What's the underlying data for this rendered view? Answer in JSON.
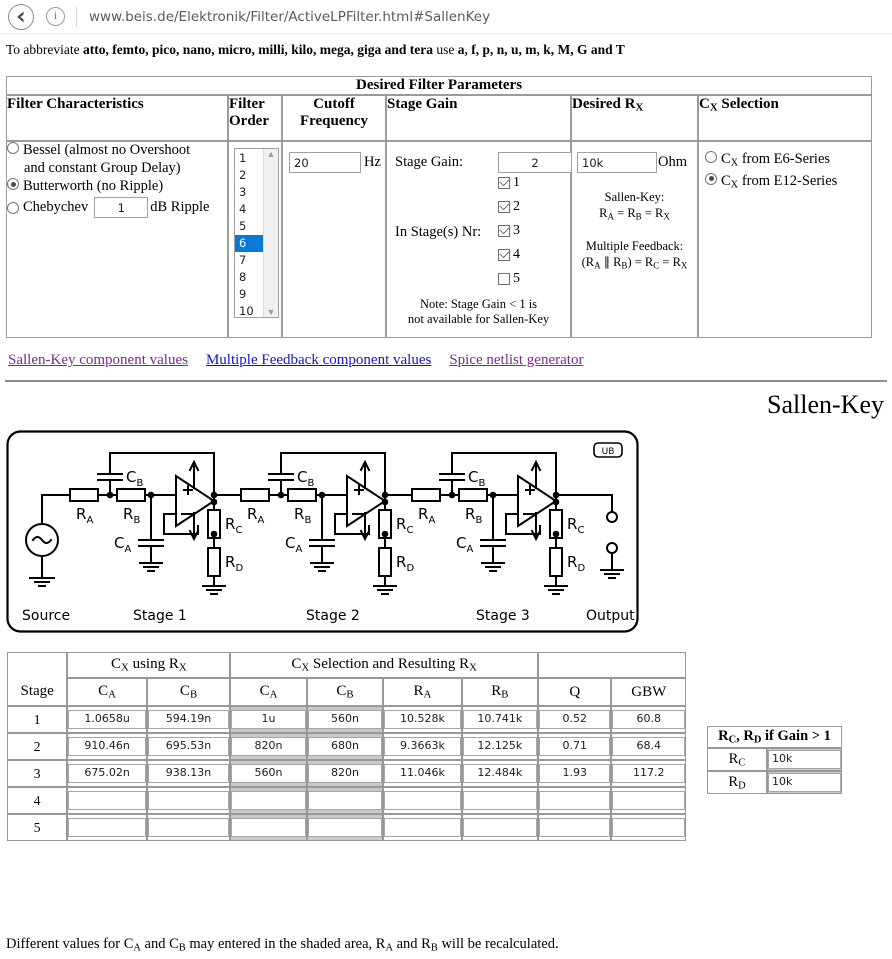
{
  "browser": {
    "back_icon": "back-arrow-icon",
    "info_icon": "info-icon",
    "url": "www.beis.de/Elektronik/Filter/ActiveLPFilter.html#SallenKey"
  },
  "abbrev_note": {
    "lead": "To abbreviate ",
    "units": "atto, femto, pico, nano, micro, milli, kilo, mega, giga and tera",
    "mid": " use ",
    "symbols": "a, f, p, n, u, m, k, M, G and T"
  },
  "param_table": {
    "caption": "Desired Filter Parameters",
    "headers": {
      "characteristics": "Filter Characteristics",
      "order": "Filter Order",
      "cutoff": "Cutoff Frequency",
      "stage_gain": "Stage Gain",
      "desired_rx": "Desired R",
      "desired_rx_sub": "X",
      "cx_selection": "C",
      "cx_selection_sub": "X",
      "cx_selection_rest": " Selection"
    },
    "characteristics": {
      "options": [
        {
          "label": "Bessel (almost no Overshoot",
          "label2": "and constant Group Delay)",
          "selected": false
        },
        {
          "label": "Butterworth (no Ripple)",
          "selected": true
        },
        {
          "label": "Chebychev",
          "selected": false
        }
      ],
      "ripple_value": "1",
      "ripple_unit": "dB Ripple"
    },
    "order": {
      "options": [
        "1",
        "2",
        "3",
        "4",
        "5",
        "6",
        "7",
        "8",
        "9",
        "10"
      ],
      "selected": "6",
      "scroll_up": "▲",
      "scroll_down": "▼"
    },
    "cutoff": {
      "value": "20",
      "unit": "Hz"
    },
    "stage_gain": {
      "label": "Stage Gain:",
      "value": "2",
      "stages_label": "In Stage(s) Nr:",
      "stages": [
        {
          "nr": "1",
          "checked": true
        },
        {
          "nr": "2",
          "checked": true
        },
        {
          "nr": "3",
          "checked": true
        },
        {
          "nr": "4",
          "checked": true
        },
        {
          "nr": "5",
          "checked": false
        }
      ],
      "note_line1": "Note: Stage Gain < 1 is",
      "note_line2": "not available for Sallen-Key"
    },
    "desired_rx": {
      "value": "10k",
      "unit": "Ohm",
      "sk_title": "Sallen-Key:",
      "sk_formula": "RA = RB = RX",
      "mf_title": "Multiple Feedback:",
      "mf_formula": "(RA || RB) = RC = RX"
    },
    "cx_selection": {
      "options": [
        {
          "label_pre": "C",
          "label_sub": "X",
          "label_post": " from E6-Series",
          "selected": false
        },
        {
          "label_pre": "C",
          "label_sub": "X",
          "label_post": " from E12-Series",
          "selected": true
        }
      ]
    }
  },
  "links": [
    {
      "label": "Sallen-Key component values",
      "state": "visited"
    },
    {
      "label": "Multiple Feedback component values",
      "state": "unvisited"
    },
    {
      "label": "Spice netlist generator",
      "state": "visited"
    }
  ],
  "section_heading": "Sallen-Key",
  "circuit": {
    "badge": "UB",
    "labels": {
      "source": "Source",
      "stage1": "Stage 1",
      "stage2": "Stage 2",
      "stage3": "Stage 3",
      "output": "Output"
    },
    "components": {
      "ra": "RA",
      "rb": "RB",
      "rc": "RC",
      "rd": "RD",
      "ca": "CA",
      "cb": "CB",
      "opamp_plus": "+",
      "opamp_minus": "−"
    }
  },
  "results_table": {
    "group_headers": {
      "blank": "",
      "cx_using_rx": "CX using RX",
      "cx_selection_resulting": "CX Selection and Resulting RX",
      "blank2": ""
    },
    "columns": [
      "Stage",
      "CA",
      "CB",
      "CA",
      "CB",
      "RA",
      "RB",
      "Q",
      "GBW"
    ],
    "rows": [
      {
        "stage": "1",
        "ca_calc": "1.0658u",
        "cb_calc": "594.19n",
        "ca_sel": "1u",
        "cb_sel": "560n",
        "ra": "10.528k",
        "rb": "10.741k",
        "q": "0.52",
        "gbw": "60.8"
      },
      {
        "stage": "2",
        "ca_calc": "910.46n",
        "cb_calc": "695.53n",
        "ca_sel": "820n",
        "cb_sel": "680n",
        "ra": "9.3663k",
        "rb": "12.125k",
        "q": "0.71",
        "gbw": "68.4"
      },
      {
        "stage": "3",
        "ca_calc": "675.02n",
        "cb_calc": "938.13n",
        "ca_sel": "560n",
        "cb_sel": "820n",
        "ra": "11.046k",
        "rb": "12.484k",
        "q": "1.93",
        "gbw": "117.2"
      },
      {
        "stage": "4",
        "ca_calc": "",
        "cb_calc": "",
        "ca_sel": "",
        "cb_sel": "",
        "ra": "",
        "rb": "",
        "q": "",
        "gbw": ""
      },
      {
        "stage": "5",
        "ca_calc": "",
        "cb_calc": "",
        "ca_sel": "",
        "cb_sel": "",
        "ra": "",
        "rb": "",
        "q": "",
        "gbw": ""
      }
    ]
  },
  "rcd_table": {
    "caption": "RC, RD if Gain > 1",
    "rows": [
      {
        "label": "RC",
        "value": "10k"
      },
      {
        "label": "RD",
        "value": "10k"
      }
    ]
  },
  "bottom_note": "Different values for CA and CB may entered in the shaded area, RA and RB will be recalculated.",
  "colors": {
    "select_highlight": "#0a7ad4",
    "link_visited": "#7b2a8e",
    "link_unvisited": "#1414c8",
    "shaded_cell": "#c9c9c9",
    "border": "#989898"
  }
}
